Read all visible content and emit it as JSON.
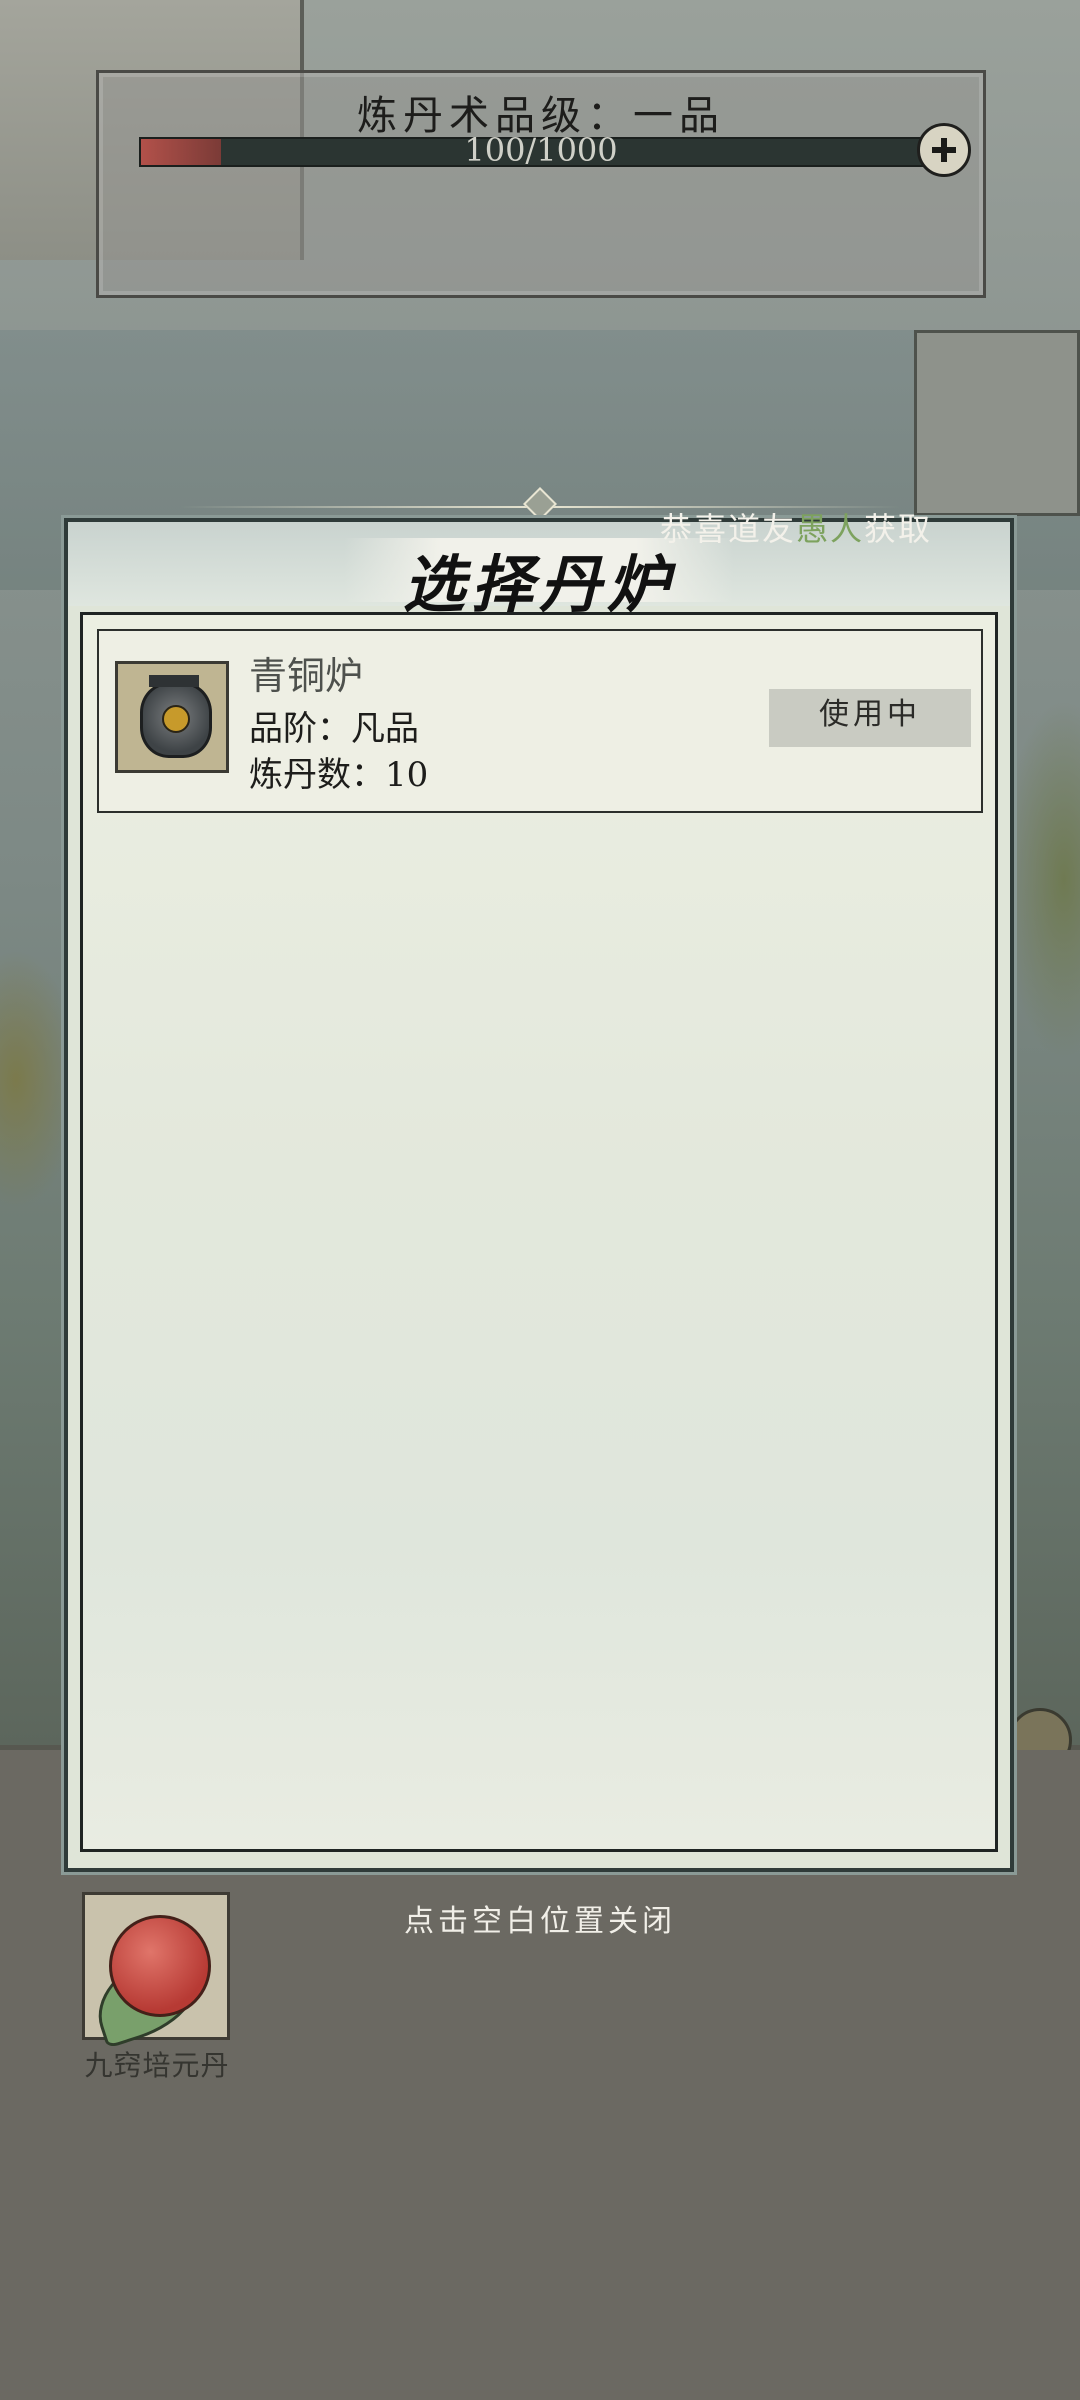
{
  "alchemy": {
    "title": "炼丹术品级：一品",
    "progress_text": "100/1000",
    "progress_current": 100,
    "progress_max": 1000
  },
  "notice": {
    "prefix": "恭喜道友",
    "name": "愚人",
    "suffix": "获取"
  },
  "modal": {
    "title": "选择丹炉",
    "furnace": {
      "name": "青铜炉",
      "grade": "品阶：凡品",
      "count": "炼丹数：10",
      "status_button": "使用中"
    }
  },
  "close_hint": "点击空白位置关闭",
  "pill": {
    "name": "九窍培元丹"
  },
  "colors": {
    "progress_fill": "#b2514a",
    "highlight_name": "#7da25e"
  },
  "icons": [
    "plus-icon",
    "bronze-furnace-icon",
    "pill-icon"
  ]
}
